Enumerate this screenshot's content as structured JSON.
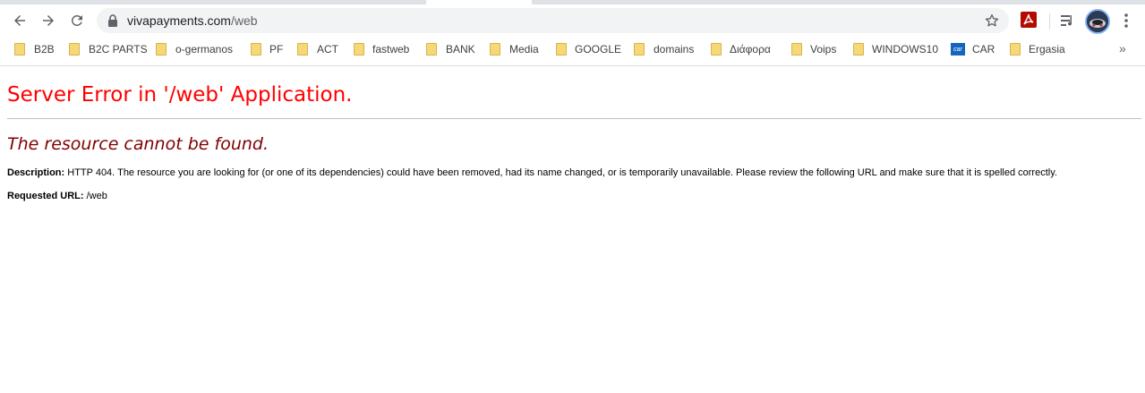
{
  "browser": {
    "url_host": "vivapayments.com",
    "url_path": "/web",
    "icons": {
      "back": "back-arrow-icon",
      "forward": "forward-arrow-icon",
      "reload": "reload-icon",
      "lock": "lock-icon",
      "bookmark_star": "star-icon",
      "extension_adobe": "adobe-acrobat-icon",
      "extension_queue": "media-queue-icon",
      "profile": "avatar",
      "menu": "more-vert-icon"
    }
  },
  "bookmarks": [
    {
      "label": "B2B",
      "icon": "folder-icon"
    },
    {
      "label": "B2C PARTS",
      "icon": "folder-icon"
    },
    {
      "label": "o-germanos",
      "icon": "folder-icon"
    },
    {
      "label": "PF",
      "icon": "folder-icon"
    },
    {
      "label": "ACT",
      "icon": "folder-icon"
    },
    {
      "label": "fastweb",
      "icon": "folder-icon"
    },
    {
      "label": "BANK",
      "icon": "folder-icon"
    },
    {
      "label": "Media",
      "icon": "folder-icon"
    },
    {
      "label": "GOOGLE",
      "icon": "folder-icon"
    },
    {
      "label": "domains",
      "icon": "folder-icon"
    },
    {
      "label": "Διάφορα",
      "icon": "folder-icon"
    },
    {
      "label": "Voips",
      "icon": "folder-icon"
    },
    {
      "label": "WINDOWS10",
      "icon": "folder-icon"
    },
    {
      "label": "CAR",
      "icon": "car-site-icon"
    },
    {
      "label": "Ergasia",
      "icon": "folder-icon"
    }
  ],
  "bookmarks_more": "»",
  "page": {
    "title": "Server Error in '/web' Application.",
    "subtitle": "The resource cannot be found.",
    "description_label": "Description:",
    "description_text": "HTTP 404. The resource you are looking for (or one of its dependencies) could have been removed, had its name changed, or is temporarily unavailable.  Please review the following URL and make sure that it is spelled correctly.",
    "requested_url_label": "Requested URL:",
    "requested_url_value": "/web"
  },
  "colors": {
    "error_title": "#ff0000",
    "error_subtitle": "#800000",
    "folder": "#f7d878",
    "car_icon": "#1565c0"
  }
}
